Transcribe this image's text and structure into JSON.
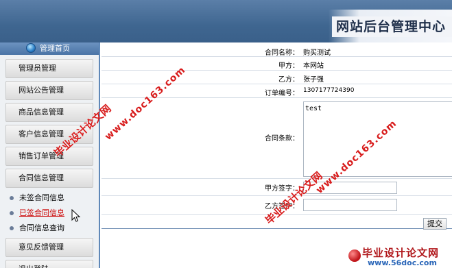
{
  "header": {
    "title": "网站后台管理中心"
  },
  "sidebar": {
    "home_label": "管理首页",
    "menu": [
      {
        "label": "管理员管理"
      },
      {
        "label": "网站公告管理"
      },
      {
        "label": "商品信息管理"
      },
      {
        "label": "客户信息管理"
      },
      {
        "label": "销售订单管理"
      },
      {
        "label": "合同信息管理"
      }
    ],
    "submenu": [
      {
        "label": "未签合同信息"
      },
      {
        "label": "已签合同信息"
      },
      {
        "label": "合同信息查询"
      }
    ],
    "menu_after": [
      {
        "label": "意见反馈管理"
      },
      {
        "label": "退出登陆"
      }
    ]
  },
  "form": {
    "contract_name_label": "合同名称：",
    "contract_name_value": "购买测试",
    "party_a_label": "甲方：",
    "party_a_value": "本网站",
    "party_b_label": "乙方：",
    "party_b_value": "张子强",
    "order_no_label": "订单编号：",
    "order_no_value": "1307177724390",
    "terms_label": "合同条款：",
    "terms_value": "test",
    "party_a_sign_label": "甲方签字：",
    "party_a_sign_value": "",
    "party_b_sign_label": "乙方签字：",
    "party_b_sign_value": "",
    "submit_label": "提交"
  },
  "watermarks": {
    "site_cn": "毕业设计论文网",
    "site_url": "www.doc163.com"
  },
  "logo": {
    "text": "毕业设计论文网",
    "url": "www.56doc.com"
  },
  "colors": {
    "header_blue": "#3f6690",
    "sidebar_blue": "#5f88b8",
    "active_link": "#cc0000",
    "watermark_red": "#d81c1c"
  }
}
